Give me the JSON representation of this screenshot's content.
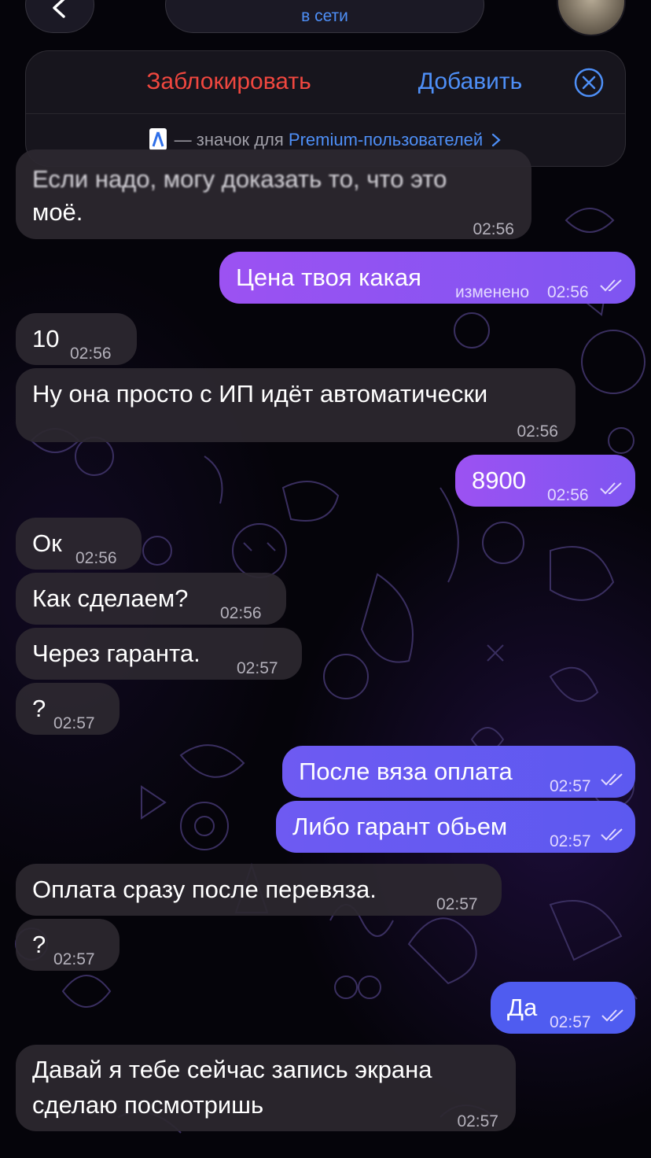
{
  "header": {
    "status": "в сети"
  },
  "action_panel": {
    "block_label": "Заблокировать",
    "add_label": "Добавить",
    "premium_note": "— значок для",
    "premium_link": "Premium-пользователей"
  },
  "messages": [
    {
      "dir": "in",
      "lines": [
        "Если надо, могу доказать то, что это",
        "моё."
      ],
      "time": "02:56"
    },
    {
      "dir": "out",
      "text": "Цена твоя какая",
      "edited": "изменено",
      "time": "02:56"
    },
    {
      "dir": "in",
      "text": "10",
      "time": "02:56"
    },
    {
      "dir": "in",
      "text": "Ну она просто с ИП идёт автоматически",
      "time": "02:56"
    },
    {
      "dir": "out",
      "text": "8900",
      "time": "02:56"
    },
    {
      "dir": "in",
      "text": "Ок",
      "time": "02:56"
    },
    {
      "dir": "in",
      "text": "Как сделаем?",
      "time": "02:56"
    },
    {
      "dir": "in",
      "text": "Через гаранта.",
      "time": "02:57"
    },
    {
      "dir": "in",
      "text": "?",
      "time": "02:57"
    },
    {
      "dir": "out",
      "text": "После вяза оплата",
      "time": "02:57"
    },
    {
      "dir": "out",
      "text": "Либо гарант обьем",
      "time": "02:57"
    },
    {
      "dir": "in",
      "text": "Оплата сразу после перевяза.",
      "time": "02:57"
    },
    {
      "dir": "in",
      "text": "?",
      "time": "02:57"
    },
    {
      "dir": "out",
      "text": "Да",
      "time": "02:57"
    },
    {
      "dir": "in",
      "lines": [
        "Давай я тебе сейчас запись экрана",
        "сделаю посмотришь"
      ],
      "time": "02:57"
    }
  ],
  "colors": {
    "accent_blue": "#4e8ff7",
    "danger_red": "#f0473f",
    "outgoing_bubble": "#7d52f0",
    "incoming_bubble": "#2c2830"
  }
}
